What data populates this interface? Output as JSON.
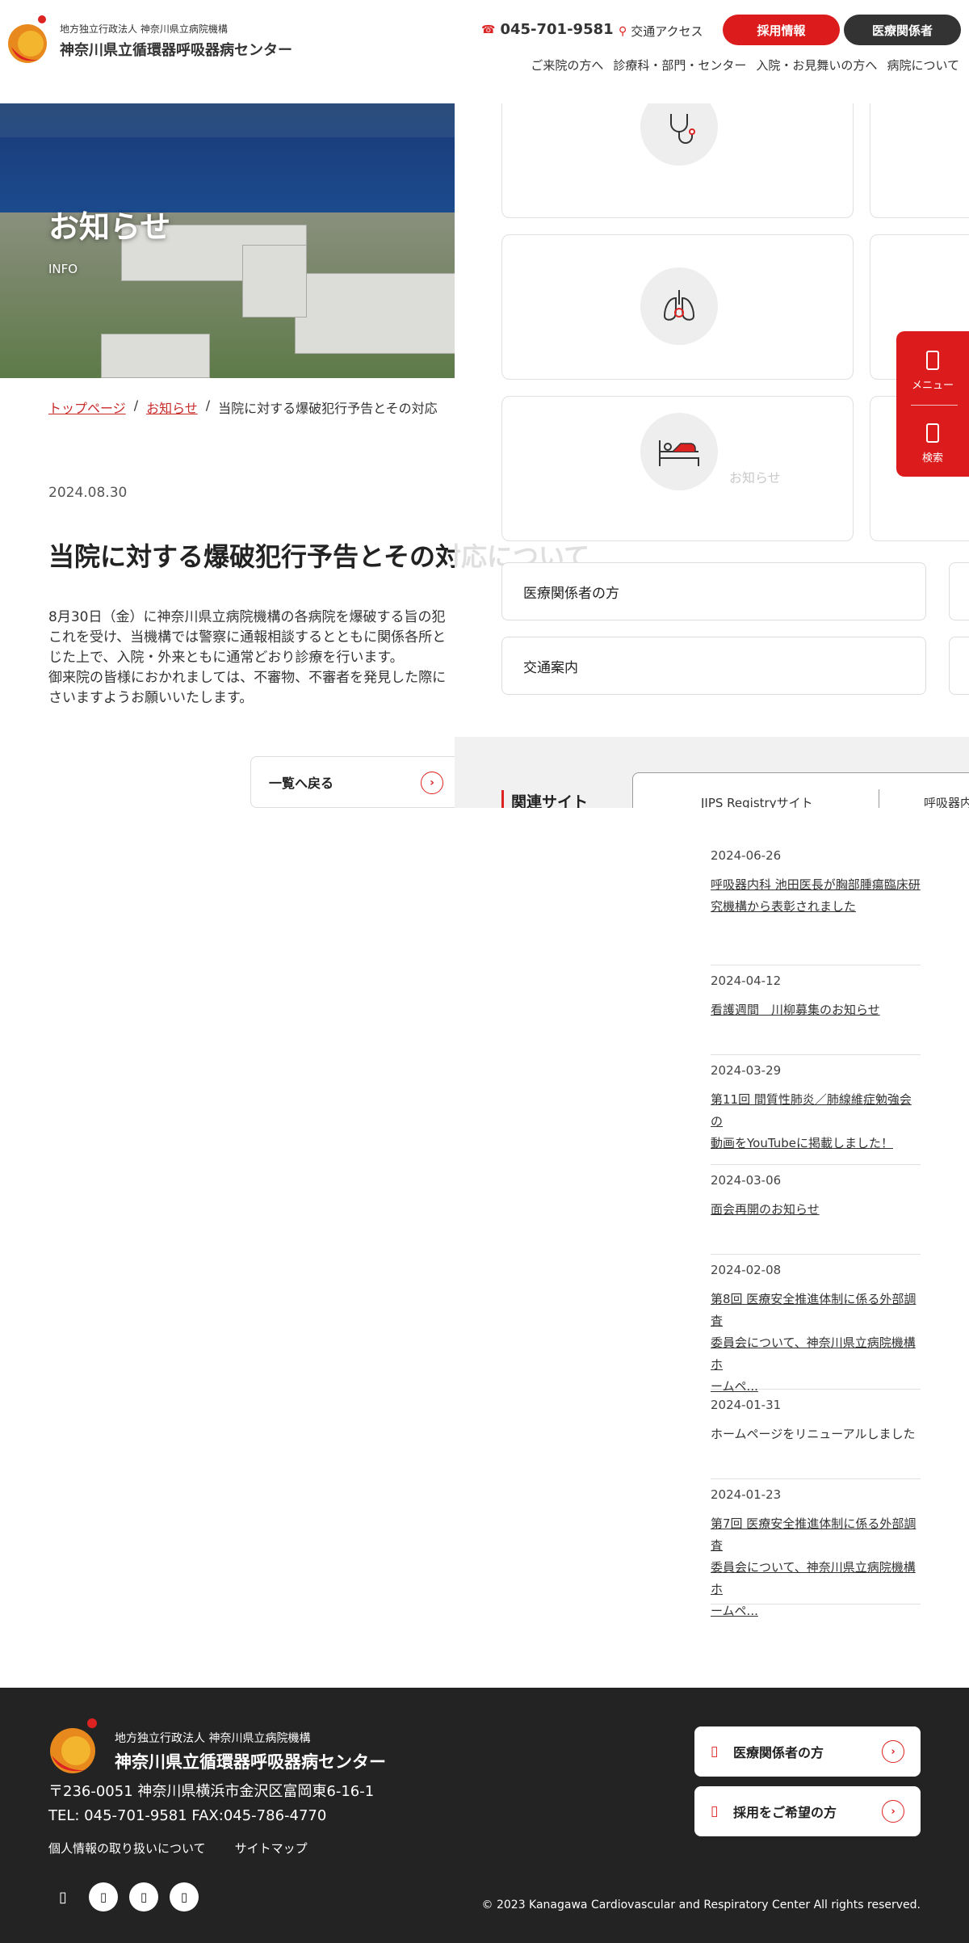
{
  "header": {
    "logo_sub": "地方独立行政法人 神奈川県立病院機構",
    "logo_main": "神奈川県立循環器呼吸器病センター",
    "tel": "045-701-9581",
    "access": "交通アクセス",
    "recruit": "採用情報",
    "medical": "医療関係者",
    "nav": [
      "ご来院の方へ",
      "診療科・部門・センター",
      "入院・お見舞いの方へ",
      "病院について"
    ]
  },
  "hero": {
    "title": "お知らせ",
    "subtitle": "INFO"
  },
  "breadcrumb": [
    "トップページ",
    "お知らせ",
    "当院に対する爆破犯行予告とその対応"
  ],
  "article": {
    "date": "2024.08.30",
    "title": "当院に対する爆破犯行予告とその対応について",
    "body": [
      "8月30日（金）に神奈川県立病院機構の各病院を爆破する旨の犯",
      "これを受け、当機構では警察に通報相談するとともに関係各所と",
      "じた上で、入院・外来ともに通常どおり診療を行います。",
      "御来院の皆様におかれましては、不審物、不審者を発見した際に",
      "さいますようお願いいたします。"
    ],
    "back_label": "一覧へ戻る"
  },
  "overlay": {
    "links": [
      "医療関係者の方",
      "交通案内"
    ],
    "ghost_text": "お知らせ",
    "related_heading": "関連サイト",
    "related_tabs": [
      "JIPS Registryサイト",
      "呼吸器内"
    ]
  },
  "side": {
    "menu": "メニュー",
    "search": "検索"
  },
  "news": [
    {
      "date": "2024-06-26",
      "title_lines": [
        "呼吸器内科 池田医長が胸部腫瘍臨床研",
        "究機構から表彰されました"
      ],
      "link": true
    },
    {
      "date": "2024-04-12",
      "title_lines": [
        "看護週間　川柳募集のお知らせ"
      ],
      "link": true
    },
    {
      "date": "2024-03-29",
      "title_lines": [
        "第11回 間質性肺炎／肺線維症勉強会の",
        "動画をYouTubeに掲載しました！"
      ],
      "link": true
    },
    {
      "date": "2024-03-06",
      "title_lines": [
        "面会再開のお知らせ"
      ],
      "link": true
    },
    {
      "date": "2024-02-08",
      "title_lines": [
        "第8回 医療安全推進体制に係る外部調査",
        "委員会について、神奈川県立病院機構ホ",
        "ームペ..."
      ],
      "link": true
    },
    {
      "date": "2024-01-31",
      "title_lines": [
        "ホームページをリニューアルしました"
      ],
      "link": false
    },
    {
      "date": "2024-01-23",
      "title_lines": [
        "第7回 医療安全推進体制に係る外部調査",
        "委員会について、神奈川県立病院機構ホ",
        "ームペ..."
      ],
      "link": true
    }
  ],
  "footer": {
    "logo_sub": "地方独立行政法人 神奈川県立病院機構",
    "logo_main": "神奈川県立循環器呼吸器病センター",
    "address": "〒236-0051 神奈川県横浜市金沢区富岡東6-16-1",
    "tel": "TEL: 045-701-9581  FAX:045-786-4770",
    "links": [
      "個人情報の取り扱いについて",
      "サイトマップ"
    ],
    "buttons": [
      "医療関係者の方",
      "採用をご希望の方"
    ],
    "copyright": "© 2023 Kanagawa Cardiovascular and Respiratory Center All rights reserved."
  },
  "colors": {
    "accent": "#dc1c1c",
    "dark": "#333333",
    "footer_bg": "#232323"
  }
}
